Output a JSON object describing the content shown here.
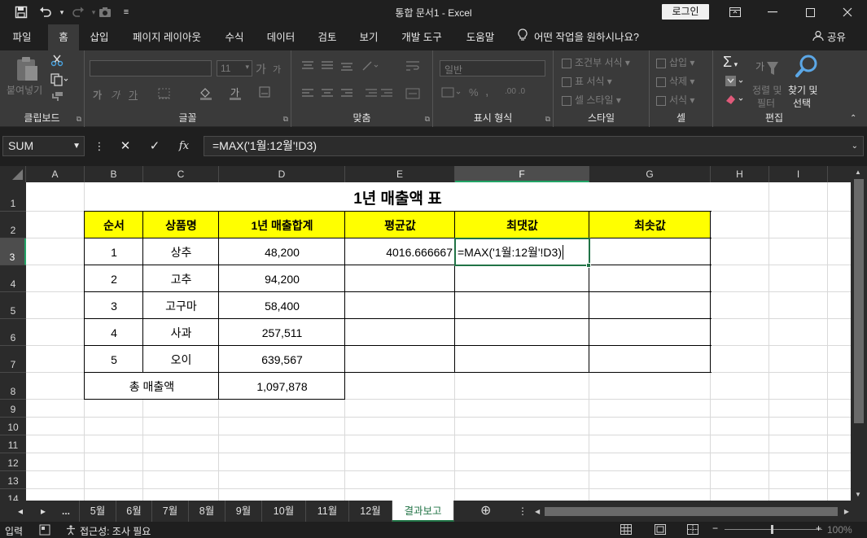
{
  "window": {
    "title": "통합 문서1  -  Excel",
    "login_label": "로그인"
  },
  "menu": {
    "tabs": [
      "파일",
      "홈",
      "삽입",
      "페이지 레이아웃",
      "수식",
      "데이터",
      "검토",
      "보기",
      "개발 도구",
      "도움말"
    ],
    "active_tab": "홈",
    "tell_me": "어떤 작업을 원하시나요?",
    "share": "공유"
  },
  "ribbon": {
    "clipboard": {
      "label": "클립보드",
      "paste": "붙여넣기"
    },
    "font": {
      "label": "글꼴",
      "size": "11",
      "bold": "가",
      "italic": "가",
      "underline": "가",
      "increase": "가",
      "decrease": "가"
    },
    "alignment": {
      "label": "맞춤"
    },
    "number": {
      "label": "표시 형식",
      "format": "일반"
    },
    "styles": {
      "label": "스타일",
      "conditional": "조건부 서식",
      "table": "표 서식",
      "cell_styles": "셀 스타일"
    },
    "cells": {
      "label": "셀",
      "insert": "삽입",
      "delete": "삭제",
      "format": "서식"
    },
    "editing": {
      "label": "편집",
      "sort_filter_1": "정렬 및",
      "sort_filter_2": "필터",
      "find_1": "찾기 및",
      "find_2": "선택"
    }
  },
  "formula_bar": {
    "name_box": "SUM",
    "formula": "=MAX('1월:12월'!D3)",
    "cancel": "✕",
    "enter": "✓",
    "fx": "fx"
  },
  "grid": {
    "columns": [
      "A",
      "B",
      "C",
      "D",
      "E",
      "F",
      "G",
      "H",
      "I"
    ],
    "rows": [
      "1",
      "2",
      "3",
      "4",
      "5",
      "6",
      "7",
      "8",
      "9",
      "10",
      "11",
      "12",
      "13",
      "14"
    ],
    "title": "1년 매출액 표",
    "headers": [
      "순서",
      "상품명",
      "1년 매출합계",
      "평균값",
      "최댓값",
      "최솟값"
    ],
    "data": [
      {
        "no": "1",
        "item": "상추",
        "total": "48,200"
      },
      {
        "no": "2",
        "item": "고추",
        "total": "94,200"
      },
      {
        "no": "3",
        "item": "고구마",
        "total": "58,400"
      },
      {
        "no": "4",
        "item": "사과",
        "total": "257,511"
      },
      {
        "no": "5",
        "item": "오이",
        "total": "639,567"
      }
    ],
    "total_label": "총 매출액",
    "total_value": "1,097,878",
    "average": "4016.666667",
    "editing_formula": "=MAX('1월:12월'!D3)",
    "header_fill": "#ffff00"
  },
  "sheets": {
    "tabs": [
      "5월",
      "6월",
      "7월",
      "8월",
      "9월",
      "10월",
      "11월",
      "12월",
      "결과보고"
    ],
    "active": "결과보고",
    "more": "..."
  },
  "status": {
    "mode": "입력",
    "accessibility": "접근성: 조사 필요",
    "zoom": "100%"
  }
}
